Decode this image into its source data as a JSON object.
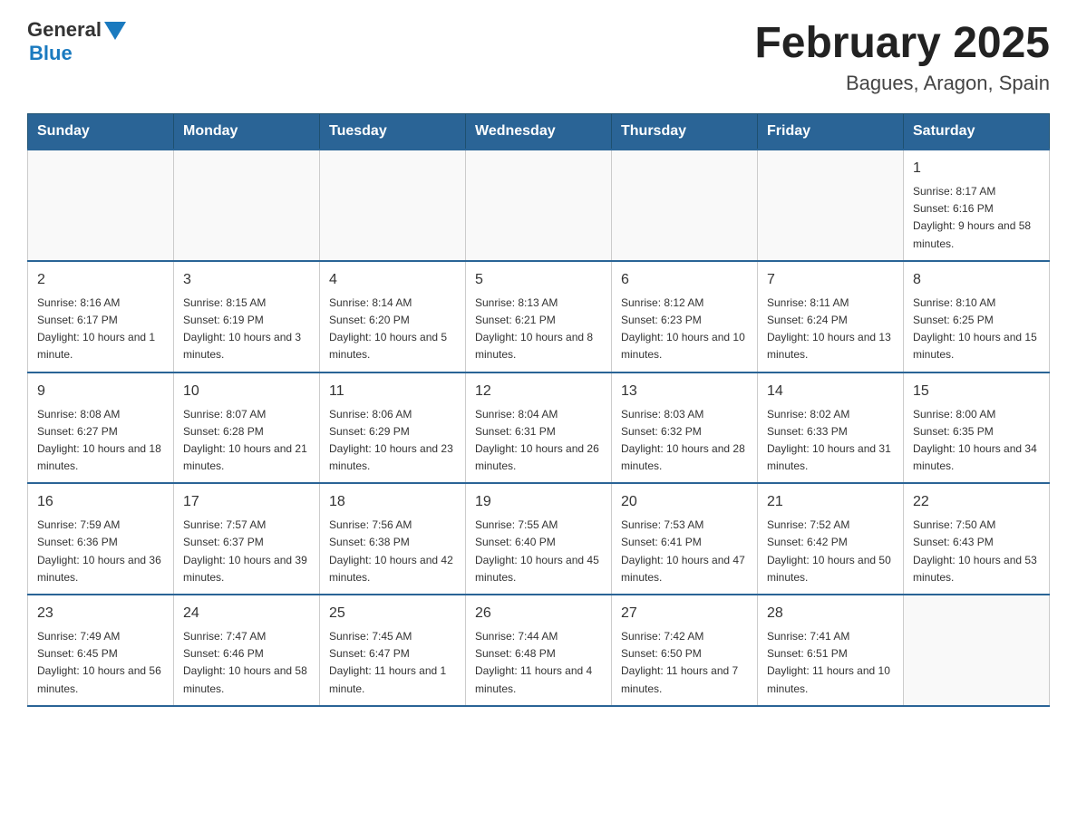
{
  "header": {
    "logo_general": "General",
    "logo_blue": "Blue",
    "month_title": "February 2025",
    "location": "Bagues, Aragon, Spain"
  },
  "weekdays": [
    "Sunday",
    "Monday",
    "Tuesday",
    "Wednesday",
    "Thursday",
    "Friday",
    "Saturday"
  ],
  "weeks": [
    [
      {
        "day": "",
        "info": ""
      },
      {
        "day": "",
        "info": ""
      },
      {
        "day": "",
        "info": ""
      },
      {
        "day": "",
        "info": ""
      },
      {
        "day": "",
        "info": ""
      },
      {
        "day": "",
        "info": ""
      },
      {
        "day": "1",
        "info": "Sunrise: 8:17 AM\nSunset: 6:16 PM\nDaylight: 9 hours and 58 minutes."
      }
    ],
    [
      {
        "day": "2",
        "info": "Sunrise: 8:16 AM\nSunset: 6:17 PM\nDaylight: 10 hours and 1 minute."
      },
      {
        "day": "3",
        "info": "Sunrise: 8:15 AM\nSunset: 6:19 PM\nDaylight: 10 hours and 3 minutes."
      },
      {
        "day": "4",
        "info": "Sunrise: 8:14 AM\nSunset: 6:20 PM\nDaylight: 10 hours and 5 minutes."
      },
      {
        "day": "5",
        "info": "Sunrise: 8:13 AM\nSunset: 6:21 PM\nDaylight: 10 hours and 8 minutes."
      },
      {
        "day": "6",
        "info": "Sunrise: 8:12 AM\nSunset: 6:23 PM\nDaylight: 10 hours and 10 minutes."
      },
      {
        "day": "7",
        "info": "Sunrise: 8:11 AM\nSunset: 6:24 PM\nDaylight: 10 hours and 13 minutes."
      },
      {
        "day": "8",
        "info": "Sunrise: 8:10 AM\nSunset: 6:25 PM\nDaylight: 10 hours and 15 minutes."
      }
    ],
    [
      {
        "day": "9",
        "info": "Sunrise: 8:08 AM\nSunset: 6:27 PM\nDaylight: 10 hours and 18 minutes."
      },
      {
        "day": "10",
        "info": "Sunrise: 8:07 AM\nSunset: 6:28 PM\nDaylight: 10 hours and 21 minutes."
      },
      {
        "day": "11",
        "info": "Sunrise: 8:06 AM\nSunset: 6:29 PM\nDaylight: 10 hours and 23 minutes."
      },
      {
        "day": "12",
        "info": "Sunrise: 8:04 AM\nSunset: 6:31 PM\nDaylight: 10 hours and 26 minutes."
      },
      {
        "day": "13",
        "info": "Sunrise: 8:03 AM\nSunset: 6:32 PM\nDaylight: 10 hours and 28 minutes."
      },
      {
        "day": "14",
        "info": "Sunrise: 8:02 AM\nSunset: 6:33 PM\nDaylight: 10 hours and 31 minutes."
      },
      {
        "day": "15",
        "info": "Sunrise: 8:00 AM\nSunset: 6:35 PM\nDaylight: 10 hours and 34 minutes."
      }
    ],
    [
      {
        "day": "16",
        "info": "Sunrise: 7:59 AM\nSunset: 6:36 PM\nDaylight: 10 hours and 36 minutes."
      },
      {
        "day": "17",
        "info": "Sunrise: 7:57 AM\nSunset: 6:37 PM\nDaylight: 10 hours and 39 minutes."
      },
      {
        "day": "18",
        "info": "Sunrise: 7:56 AM\nSunset: 6:38 PM\nDaylight: 10 hours and 42 minutes."
      },
      {
        "day": "19",
        "info": "Sunrise: 7:55 AM\nSunset: 6:40 PM\nDaylight: 10 hours and 45 minutes."
      },
      {
        "day": "20",
        "info": "Sunrise: 7:53 AM\nSunset: 6:41 PM\nDaylight: 10 hours and 47 minutes."
      },
      {
        "day": "21",
        "info": "Sunrise: 7:52 AM\nSunset: 6:42 PM\nDaylight: 10 hours and 50 minutes."
      },
      {
        "day": "22",
        "info": "Sunrise: 7:50 AM\nSunset: 6:43 PM\nDaylight: 10 hours and 53 minutes."
      }
    ],
    [
      {
        "day": "23",
        "info": "Sunrise: 7:49 AM\nSunset: 6:45 PM\nDaylight: 10 hours and 56 minutes."
      },
      {
        "day": "24",
        "info": "Sunrise: 7:47 AM\nSunset: 6:46 PM\nDaylight: 10 hours and 58 minutes."
      },
      {
        "day": "25",
        "info": "Sunrise: 7:45 AM\nSunset: 6:47 PM\nDaylight: 11 hours and 1 minute."
      },
      {
        "day": "26",
        "info": "Sunrise: 7:44 AM\nSunset: 6:48 PM\nDaylight: 11 hours and 4 minutes."
      },
      {
        "day": "27",
        "info": "Sunrise: 7:42 AM\nSunset: 6:50 PM\nDaylight: 11 hours and 7 minutes."
      },
      {
        "day": "28",
        "info": "Sunrise: 7:41 AM\nSunset: 6:51 PM\nDaylight: 11 hours and 10 minutes."
      },
      {
        "day": "",
        "info": ""
      }
    ]
  ]
}
